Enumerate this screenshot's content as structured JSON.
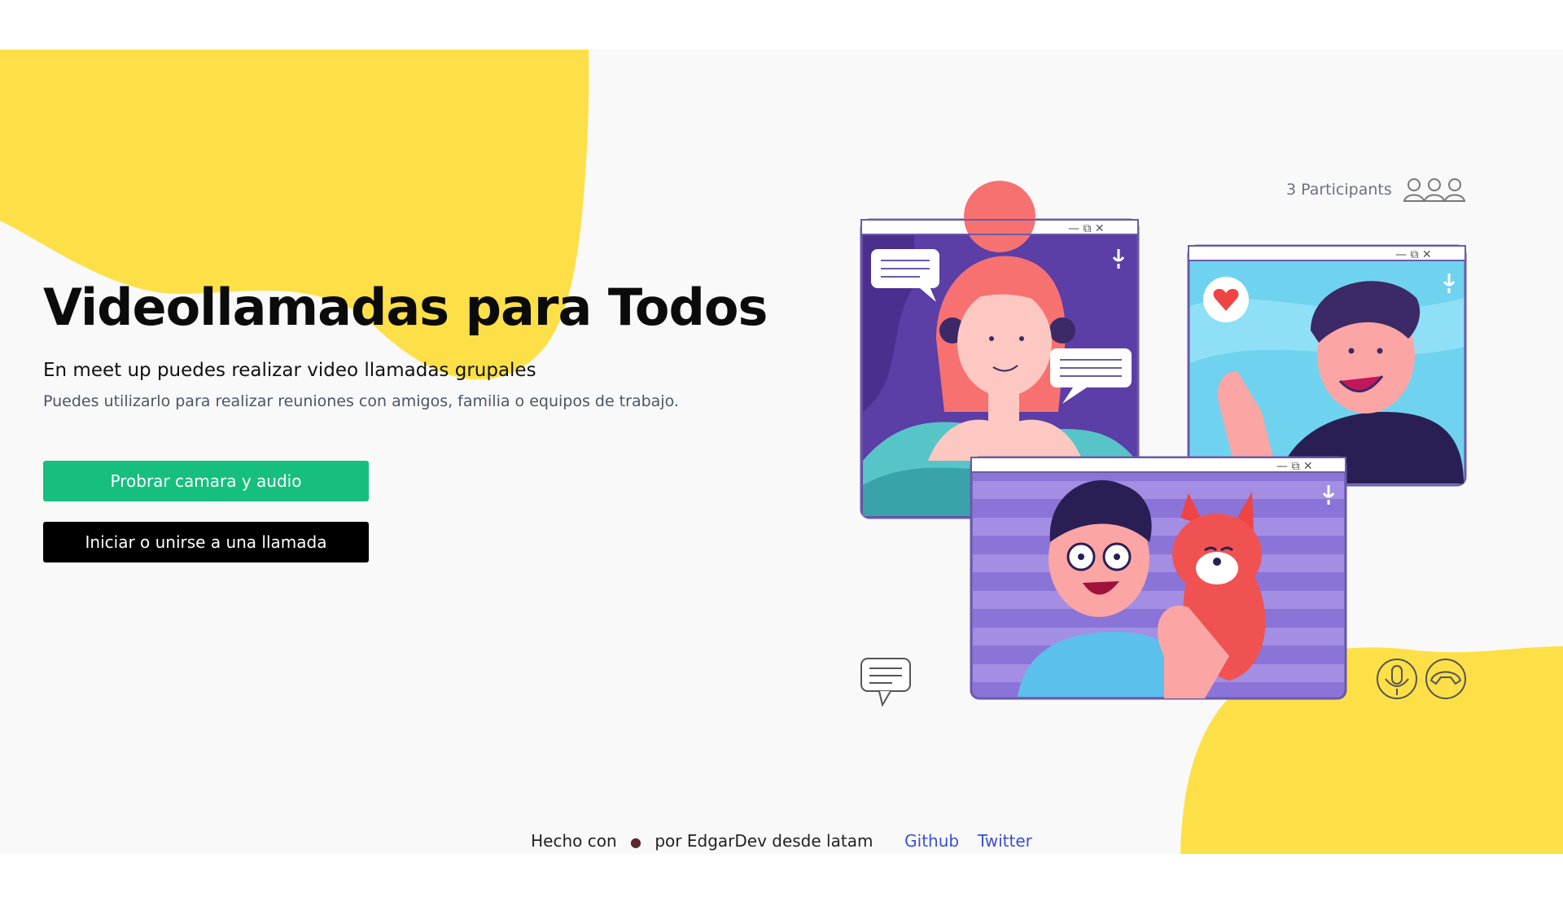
{
  "hero": {
    "title": "Videollamadas para Todos",
    "subtitle": "En meet up puedes realizar video llamadas grupales",
    "description": "Puedes utilizarlo para realizar reuniones con amigos, familia o equipos de trabajo."
  },
  "buttons": {
    "test_label": "Probrar camara y audio",
    "join_label": "Iniciar o unirse a una llamada"
  },
  "illustration": {
    "participants_label": "3 Participants",
    "icons": [
      "participants-icon",
      "chat-icon",
      "microphone-icon",
      "hang-up-icon"
    ]
  },
  "footer": {
    "made_with": "Hecho con",
    "heart_icon": "heart-icon",
    "by_text": "por EdgarDev desde latam",
    "github_label": "Github",
    "twitter_label": "Twitter"
  },
  "colors": {
    "accent_yellow": "#fde047",
    "primary_green": "#17bf7e",
    "button_dark": "#000000",
    "link_blue": "#3b4fd6"
  }
}
